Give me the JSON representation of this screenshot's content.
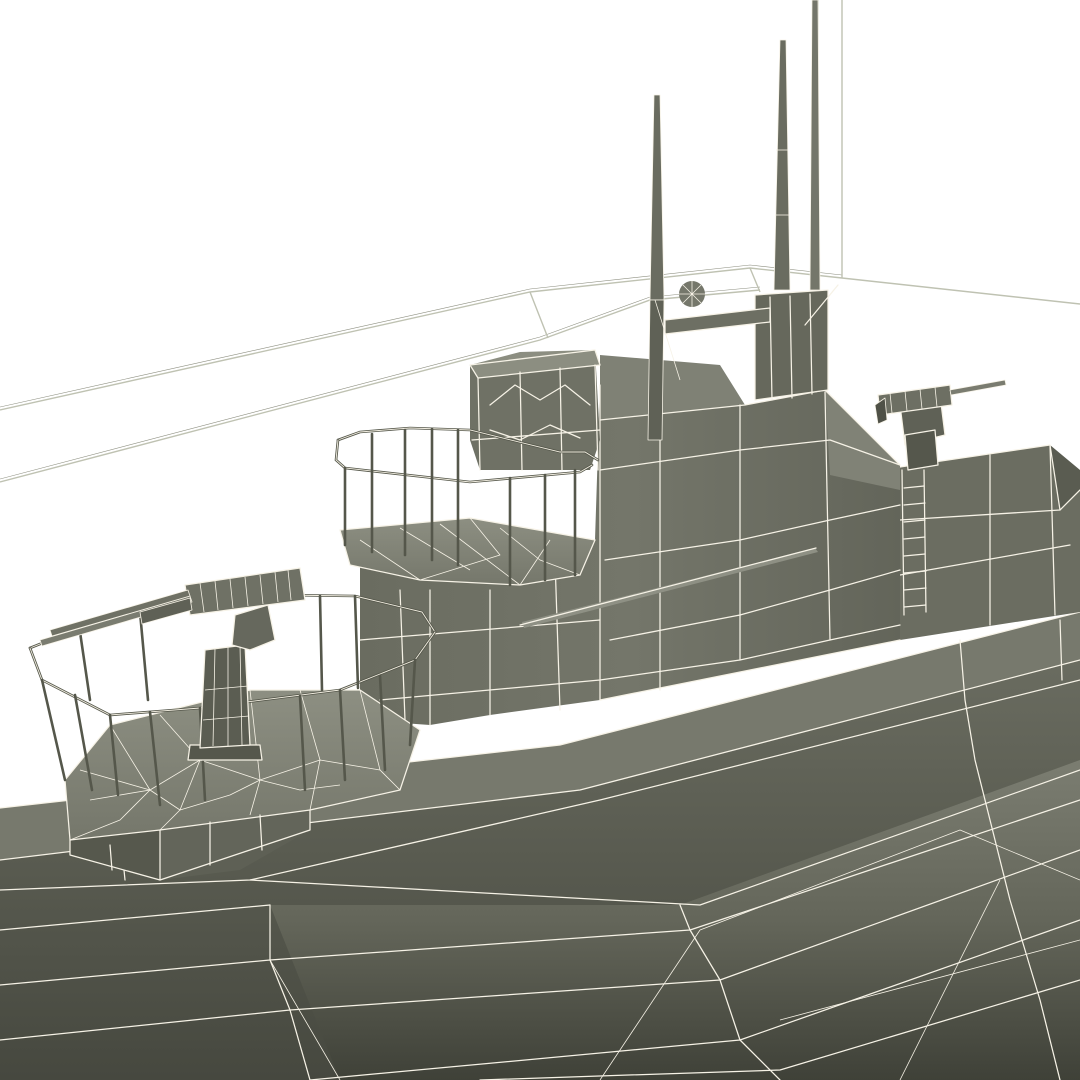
{
  "scene": {
    "subject": "submarine-wireframe-render",
    "colors": {
      "background": "#ffffff",
      "hull_dark": "#4d4f45",
      "hull_mid": "#6a6c60",
      "hull_light": "#8a8c7f",
      "wireframe": "#f6f2e6",
      "cable": "#bfc2b2"
    }
  }
}
